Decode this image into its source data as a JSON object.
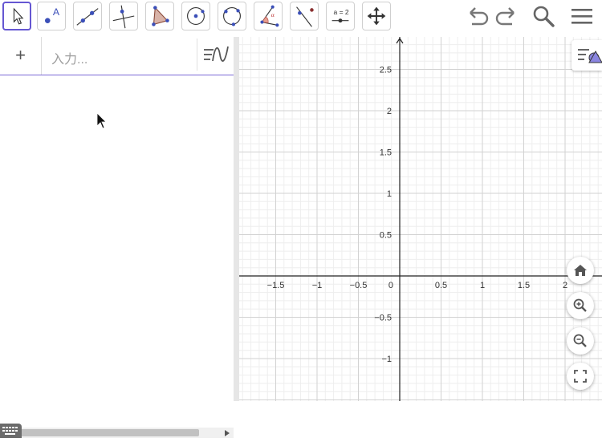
{
  "toolbar": {
    "tools": [
      {
        "name": "move-tool",
        "active": true
      },
      {
        "name": "point-tool"
      },
      {
        "name": "line-tool"
      },
      {
        "name": "perpendicular-line-tool"
      },
      {
        "name": "polygon-tool"
      },
      {
        "name": "circle-center-point-tool"
      },
      {
        "name": "circle-three-points-tool"
      },
      {
        "name": "angle-tool"
      },
      {
        "name": "reflect-tool"
      },
      {
        "name": "slider-tool",
        "label": "a = 2"
      },
      {
        "name": "move-graphics-view-tool"
      }
    ],
    "actions": [
      "undo-icon",
      "redo-icon",
      "search-icon",
      "menu-icon"
    ],
    "accent_color": "#6557d2"
  },
  "algebra": {
    "plus_label": "+",
    "input_placeholder": "入力..."
  },
  "graphics": {
    "x_ticks": [
      "−1.5",
      "−1",
      "−0.5",
      "0",
      "0.5",
      "1",
      "1.5",
      "2"
    ],
    "y_ticks_pos": [
      "2.5",
      "2",
      "1.5",
      "1",
      "0.5"
    ],
    "y_ticks_neg": [
      "−0.5",
      "−1"
    ],
    "buttons": [
      "home-icon",
      "zoom-in-icon",
      "zoom-out-icon",
      "fullscreen-icon"
    ]
  }
}
